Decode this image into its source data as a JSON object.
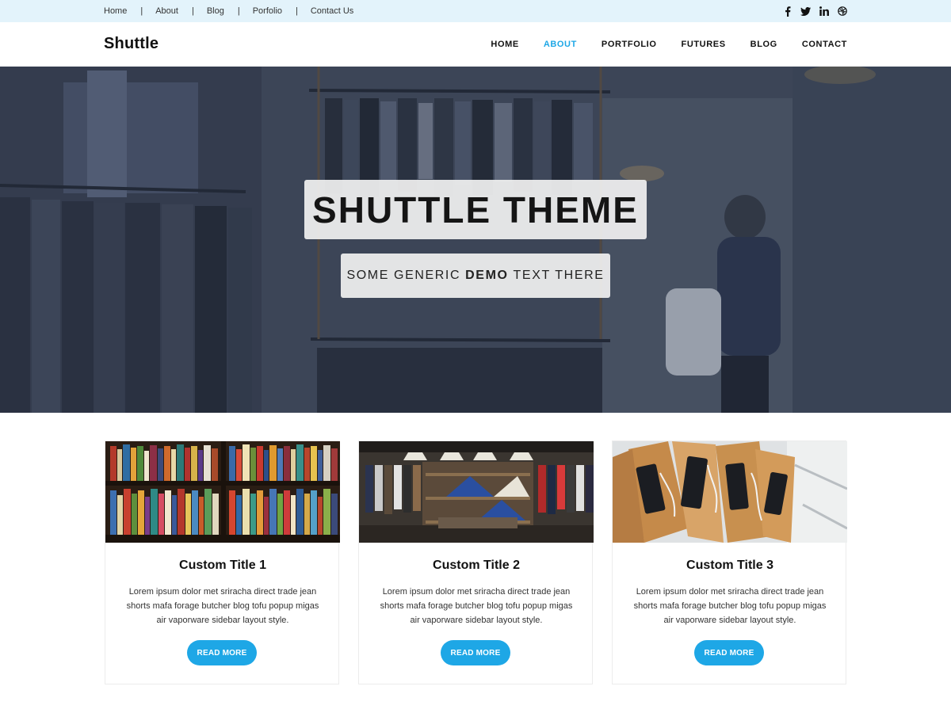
{
  "topbar": {
    "links": [
      "Home",
      "About",
      "Blog",
      "Porfolio",
      "Contact Us"
    ],
    "separator": "|",
    "social_icons": [
      "facebook-icon",
      "twitter-icon",
      "linkedin-icon",
      "dribbble-icon"
    ]
  },
  "header": {
    "logo": "Shuttle",
    "nav": [
      "HOME",
      "ABOUT",
      "PORTFOLIO",
      "FUTURES",
      "BLOG",
      "CONTACT"
    ],
    "active_nav": "ABOUT"
  },
  "hero": {
    "title": "SHUTTLE THEME",
    "subtitle_pre": "SOME GENERIC",
    "subtitle_bold": "DEMO",
    "subtitle_post": "TEXT THERE"
  },
  "cards": [
    {
      "title": "Custom Title 1",
      "text": "Lorem ipsum dolor met sriracha direct trade jean shorts mafa forage butcher blog tofu popup migas air vaporware sidebar layout style.",
      "button": "READ MORE",
      "image": "bookshelf"
    },
    {
      "title": "Custom Title 2",
      "text": "Lorem ipsum dolor met sriracha direct trade jean shorts mafa forage butcher blog tofu popup migas air vaporware sidebar layout style.",
      "button": "READ MORE",
      "image": "clothing-store"
    },
    {
      "title": "Custom Title 3",
      "text": "Lorem ipsum dolor met sriracha direct trade jean shorts mafa forage butcher blog tofu popup migas air vaporware sidebar layout style.",
      "button": "READ MORE",
      "image": "shopping-bags"
    }
  ],
  "colors": {
    "accent": "#1ea7e6",
    "topbar_bg": "#e3f3fb"
  }
}
